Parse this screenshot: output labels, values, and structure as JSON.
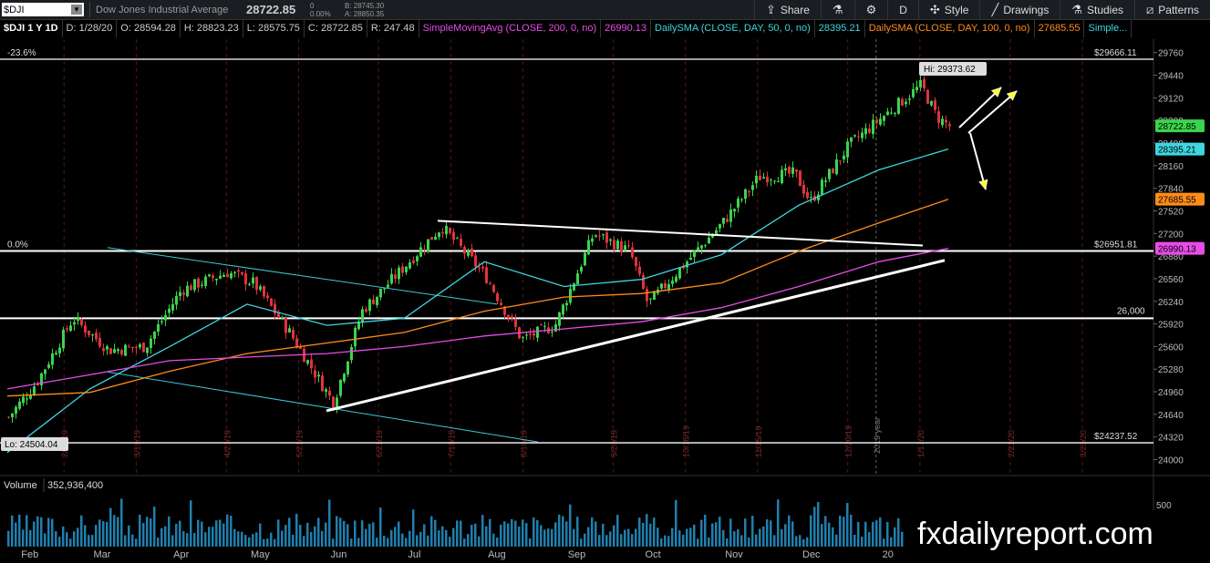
{
  "toolbar": {
    "symbol": "$DJI",
    "description": "Dow Jones Industrial Average",
    "last_price": "28722.85",
    "net_change": "0",
    "pct_change": "0.00%",
    "bid": "B: 28745.30",
    "ask": "A: 28850.35",
    "share_label": "Share",
    "aggregation": "D",
    "style_label": "Style",
    "drawings_label": "Drawings",
    "studies_label": "Studies",
    "patterns_label": "Patterns"
  },
  "infobar": {
    "symbol": "$DJI 1 Y 1D",
    "date": "D: 1/28/20",
    "open": "O: 28594.28",
    "high": "H: 28823.23",
    "low": "L: 28575.75",
    "close": "C: 28722.85",
    "range": "R: 247.48",
    "sma200": "SimpleMovingAvg (CLOSE, 200, 0, no)",
    "sma200_val": "26990.13",
    "sma50": "DailySMA (CLOSE, DAY, 50, 0, no)",
    "sma50_val": "28395.21",
    "sma100": "DailySMA (CLOSE, DAY, 100, 0, no)",
    "sma100_val": "27685.55",
    "more": "Simple..."
  },
  "volume": {
    "label": "Volume",
    "value": "352,936,400",
    "axis_label": "500"
  },
  "tags": {
    "last": "28722.85",
    "sma50": "28395.21",
    "sma100": "27685.55",
    "sma200": "26990.13"
  },
  "annotations": {
    "fib_top": "-23.6%",
    "fib_zero": "0.0%",
    "level_top": "$29666.11",
    "level_mid": "$26951.81",
    "level_26000": "26,000",
    "level_bottom": "$24237.52",
    "hi": "Hi: 29373.62",
    "lo": "Lo: 24504.04",
    "year_marker": "2019 year"
  },
  "colors": {
    "up": "#3bd34d",
    "down": "#e0333c",
    "sma50": "#3fd6e0",
    "sma100": "#ff8c1a",
    "sma200": "#e84ce8",
    "volume": "#1f7fae",
    "arrow": "#ffff33"
  },
  "watermark": "fxdailyreport.com",
  "chart_data": {
    "type": "line",
    "title": "$DJI 1 Y 1D",
    "xlabel": "",
    "ylabel": "",
    "ylim": [
      23800,
      29950
    ],
    "y_ticks": [
      24000,
      24320,
      24640,
      24960,
      25280,
      25600,
      25920,
      26240,
      26560,
      26880,
      27200,
      27520,
      27840,
      28160,
      28480,
      28800,
      29120,
      29440,
      29760
    ],
    "x_ticks": [
      "Feb",
      "Mar",
      "Apr",
      "May",
      "Jun",
      "Jul",
      "Aug",
      "Sep",
      "Oct",
      "Nov",
      "Dec",
      "20"
    ],
    "x_start": "2019-01-28",
    "x_end": "2020-01-28",
    "week_ticks": [
      "2/19/19",
      "3/19/19",
      "4/23/19",
      "5/21/19",
      "6/21/19",
      "7/19/19",
      "8/16/19",
      "9/20/19",
      "10/18/19",
      "11/15/19",
      "12/20/19",
      "1/17/20",
      "2/21/20",
      "3/20/20"
    ],
    "series": [
      {
        "name": "Price",
        "x": [
          "2019-01-28",
          "2019-02-08",
          "2019-02-22",
          "2019-03-08",
          "2019-03-22",
          "2019-04-05",
          "2019-04-23",
          "2019-05-03",
          "2019-05-17",
          "2019-06-03",
          "2019-06-14",
          "2019-07-01",
          "2019-07-15",
          "2019-08-01",
          "2019-08-15",
          "2019-08-28",
          "2019-09-12",
          "2019-09-26",
          "2019-10-03",
          "2019-10-18",
          "2019-11-01",
          "2019-11-15",
          "2019-11-29",
          "2019-12-05",
          "2019-12-20",
          "2020-01-02",
          "2020-01-17",
          "2020-01-23",
          "2020-01-28"
        ],
        "values": [
          24600,
          25100,
          26000,
          25550,
          25600,
          26400,
          26650,
          26500,
          25800,
          24800,
          26100,
          26750,
          27300,
          26600,
          25700,
          25900,
          27200,
          26950,
          26200,
          26800,
          27350,
          28000,
          28050,
          27650,
          28450,
          28850,
          29300,
          28850,
          28722
        ]
      },
      {
        "name": "SMA 50",
        "x": [
          "2019-01-28",
          "2019-03-01",
          "2019-04-01",
          "2019-05-01",
          "2019-06-01",
          "2019-07-01",
          "2019-08-01",
          "2019-09-01",
          "2019-10-01",
          "2019-11-01",
          "2019-12-01",
          "2020-01-01",
          "2020-01-28"
        ],
        "values": [
          24100,
          25000,
          25600,
          26200,
          25900,
          26000,
          26800,
          26450,
          26550,
          26900,
          27600,
          28100,
          28395
        ]
      },
      {
        "name": "SMA 100",
        "x": [
          "2019-01-28",
          "2019-03-01",
          "2019-04-01",
          "2019-05-01",
          "2019-06-01",
          "2019-07-01",
          "2019-08-01",
          "2019-09-01",
          "2019-10-01",
          "2019-11-01",
          "2019-12-01",
          "2020-01-01",
          "2020-01-28"
        ],
        "values": [
          24900,
          24950,
          25250,
          25500,
          25650,
          25800,
          26100,
          26300,
          26350,
          26500,
          26950,
          27350,
          27685
        ]
      },
      {
        "name": "SMA 200",
        "x": [
          "2019-01-28",
          "2019-03-01",
          "2019-04-01",
          "2019-05-01",
          "2019-06-01",
          "2019-07-01",
          "2019-08-01",
          "2019-09-01",
          "2019-10-01",
          "2019-11-01",
          "2019-12-01",
          "2020-01-01",
          "2020-01-28"
        ],
        "values": [
          25000,
          25200,
          25400,
          25450,
          25500,
          25600,
          25750,
          25850,
          25950,
          26150,
          26450,
          26800,
          26990
        ]
      }
    ],
    "levels": [
      29666.11,
      26951.81,
      26000,
      24237.52
    ],
    "grid": false,
    "legend": "top-left"
  }
}
